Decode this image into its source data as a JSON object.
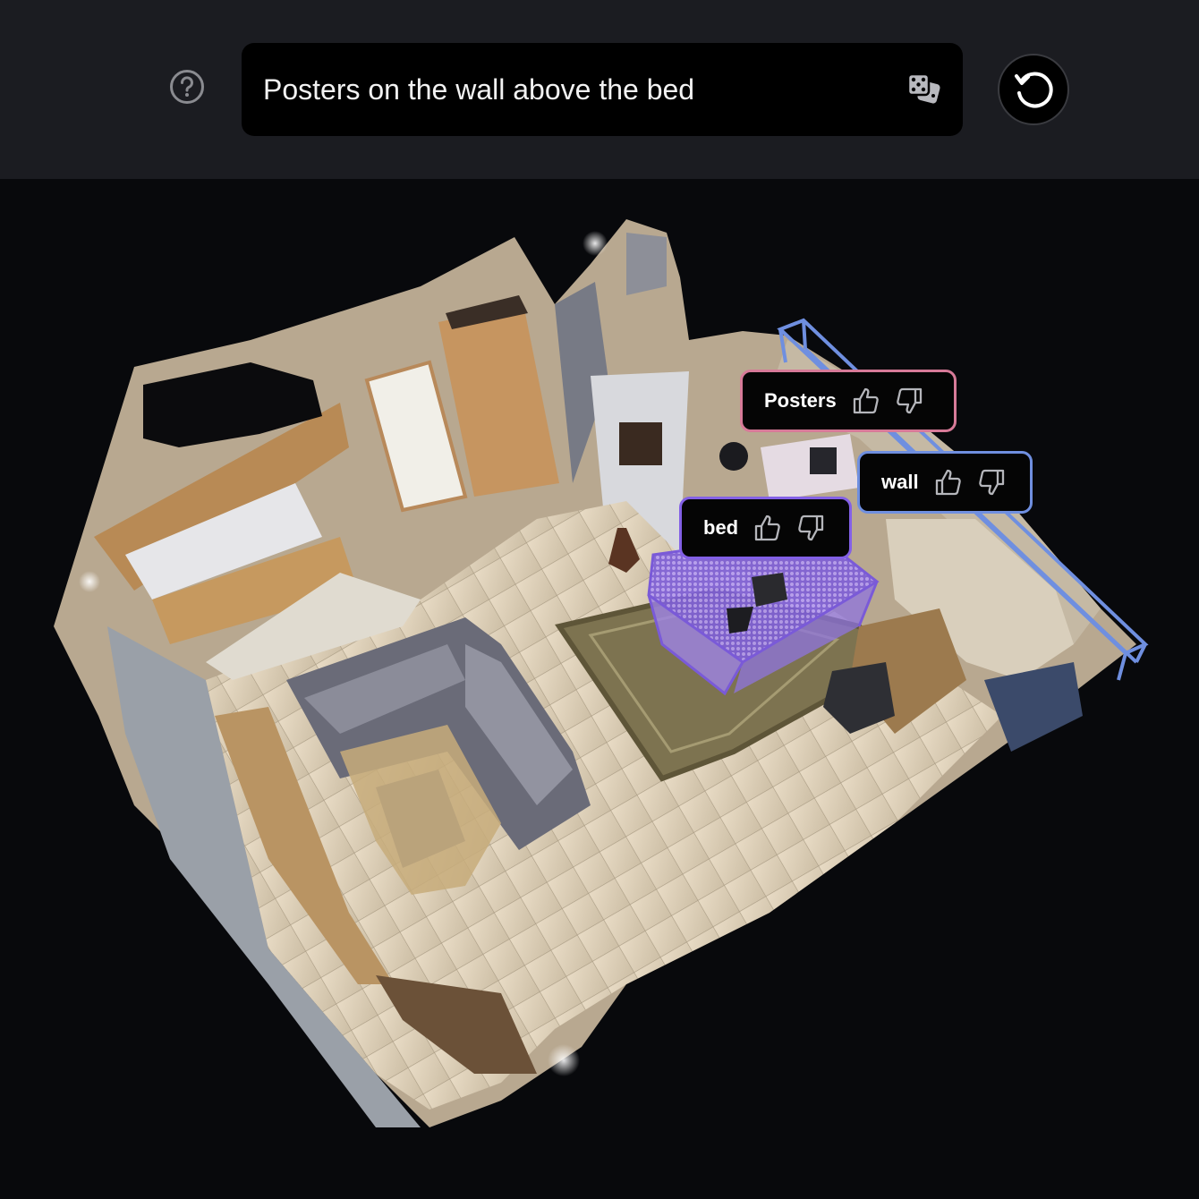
{
  "search": {
    "value": "Posters on the wall above the bed",
    "placeholder": ""
  },
  "toolbar": {
    "help_icon": "question-circle-icon",
    "random_icon": "dice-icon",
    "reset_icon": "reset-icon"
  },
  "labels": [
    {
      "text": "Posters",
      "color": "#d77a98"
    },
    {
      "text": "wall",
      "color": "#6f8fe0"
    },
    {
      "text": "bed",
      "color": "#8360e6"
    }
  ]
}
